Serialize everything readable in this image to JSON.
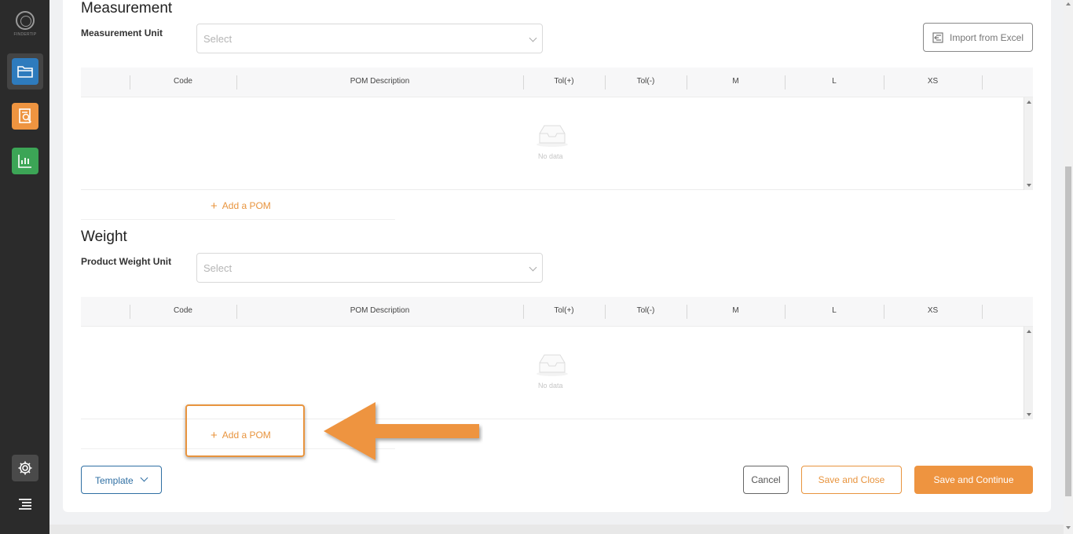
{
  "sidebar": {
    "logo_text": "FINDERTIP",
    "items": [
      {
        "icon": "folder-icon",
        "color": "#2e7bbd"
      },
      {
        "icon": "document-search-icon",
        "color": "#ee9440"
      },
      {
        "icon": "bar-chart-icon",
        "color": "#3ca556"
      }
    ],
    "settings_icon": "gear-icon",
    "menu_icon": "menu-icon"
  },
  "measurement": {
    "title": "Measurement",
    "unit_label": "Measurement Unit",
    "select_placeholder": "Select",
    "import_label": "Import from Excel"
  },
  "weight": {
    "title": "Weight",
    "unit_label": "Product Weight Unit",
    "select_placeholder": "Select"
  },
  "table": {
    "columns": [
      "Code",
      "POM Description",
      "Tol(+)",
      "Tol(-)",
      "M",
      "L",
      "XS"
    ],
    "empty_text": "No data",
    "add_label": "Add a POM"
  },
  "footer": {
    "template_label": "Template",
    "cancel_label": "Cancel",
    "save_close_label": "Save and Close",
    "save_continue_label": "Save and Continue"
  },
  "colors": {
    "accent": "#ee9440",
    "primary": "#2f6fa3"
  }
}
